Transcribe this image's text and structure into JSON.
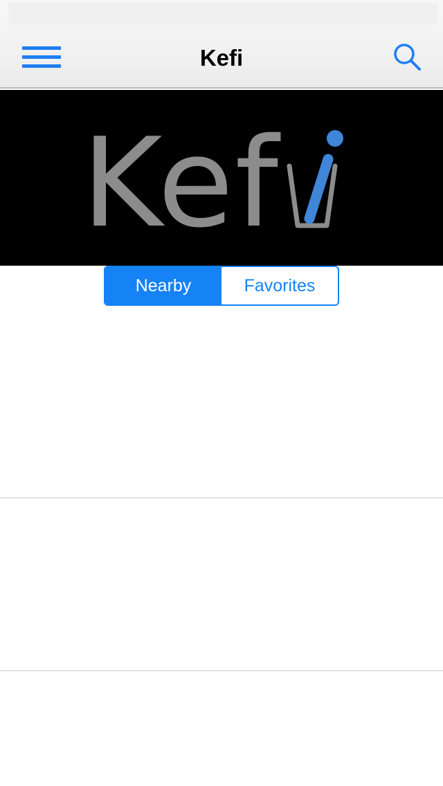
{
  "navbar": {
    "title": "Kefi",
    "menu_icon": "hamburger-menu-icon",
    "search_icon": "search-icon",
    "accent_color": "#1e7ef2"
  },
  "banner": {
    "logo_text": "Kefi",
    "logo_text_color": "#8c8c8c",
    "logo_accent_color": "#3f86d9",
    "background_color": "#000000"
  },
  "segmented_control": {
    "selected": "Nearby",
    "segments": [
      {
        "label": "Nearby"
      },
      {
        "label": "Favorites"
      }
    ],
    "accent_color": "#1582f6"
  },
  "list": {
    "rows": [
      {},
      {},
      {}
    ]
  }
}
